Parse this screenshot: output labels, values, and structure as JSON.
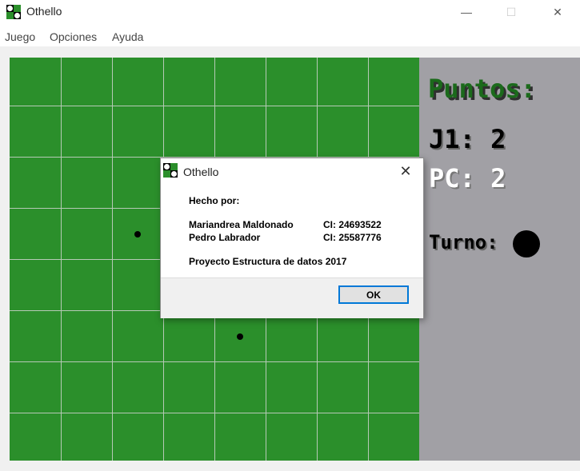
{
  "window": {
    "title": "Othello",
    "minimize": "—",
    "maximize": "☐",
    "close": "✕"
  },
  "menu": {
    "items": [
      "Juego",
      "Opciones",
      "Ayuda"
    ]
  },
  "scores": {
    "heading": "Puntos:",
    "j1": "J1: 2",
    "pc": "PC: 2",
    "turn_label": "Turno:"
  },
  "dialog": {
    "title": "Othello",
    "close": "✕",
    "made_by": "Hecho por:",
    "authors": [
      {
        "name": "Mariandrea Maldonado",
        "ci": "CI: 24693522"
      },
      {
        "name": "Pedro Labrador",
        "ci": "CI: 25587776"
      }
    ],
    "project": "Proyecto Estructura de datos 2017",
    "ok": "OK"
  },
  "colors": {
    "board": "#2b8f2b",
    "panel": "#a1a0a5",
    "accent": "#0078d7"
  }
}
